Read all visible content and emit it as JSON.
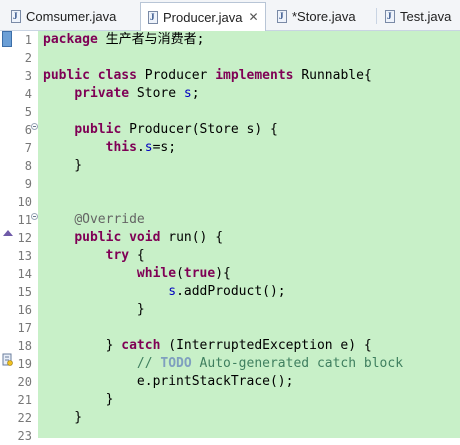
{
  "tabs": [
    {
      "label": "Comsumer.java",
      "active": false,
      "icon": "java-file-icon"
    },
    {
      "label": "Producer.java",
      "active": true,
      "icon": "java-file-icon",
      "close": "✕"
    },
    {
      "label": "*Store.java",
      "active": false,
      "icon": "java-file-icon"
    },
    {
      "label": "Test.java",
      "active": false,
      "icon": "java-file-icon"
    }
  ],
  "editor": {
    "highlight_color": "#c8f0c8",
    "keyword_color": "#7f0055",
    "field_color": "#0000c0",
    "comment_color": "#3f7f5f",
    "line_numbers": [
      "1",
      "2",
      "3",
      "4",
      "5",
      "6",
      "7",
      "8",
      "9",
      "10",
      "11",
      "12",
      "13",
      "14",
      "15",
      "16",
      "17",
      "18",
      "19",
      "20",
      "21",
      "22",
      "23"
    ],
    "lines": [
      "package 生产者与消费者;",
      "",
      "public class Producer implements Runnable{",
      "    private Store s;",
      "",
      "    public Producer(Store s) {",
      "        this.s=s;",
      "    }",
      "",
      "",
      "    @Override",
      "    public void run() {",
      "        try {",
      "            while(true){",
      "                s.addProduct();",
      "            }",
      "",
      "        } catch (InterruptedException e) {",
      "            // TODO Auto-generated catch block",
      "            e.printStackTrace();",
      "        }",
      "    }",
      ""
    ]
  }
}
